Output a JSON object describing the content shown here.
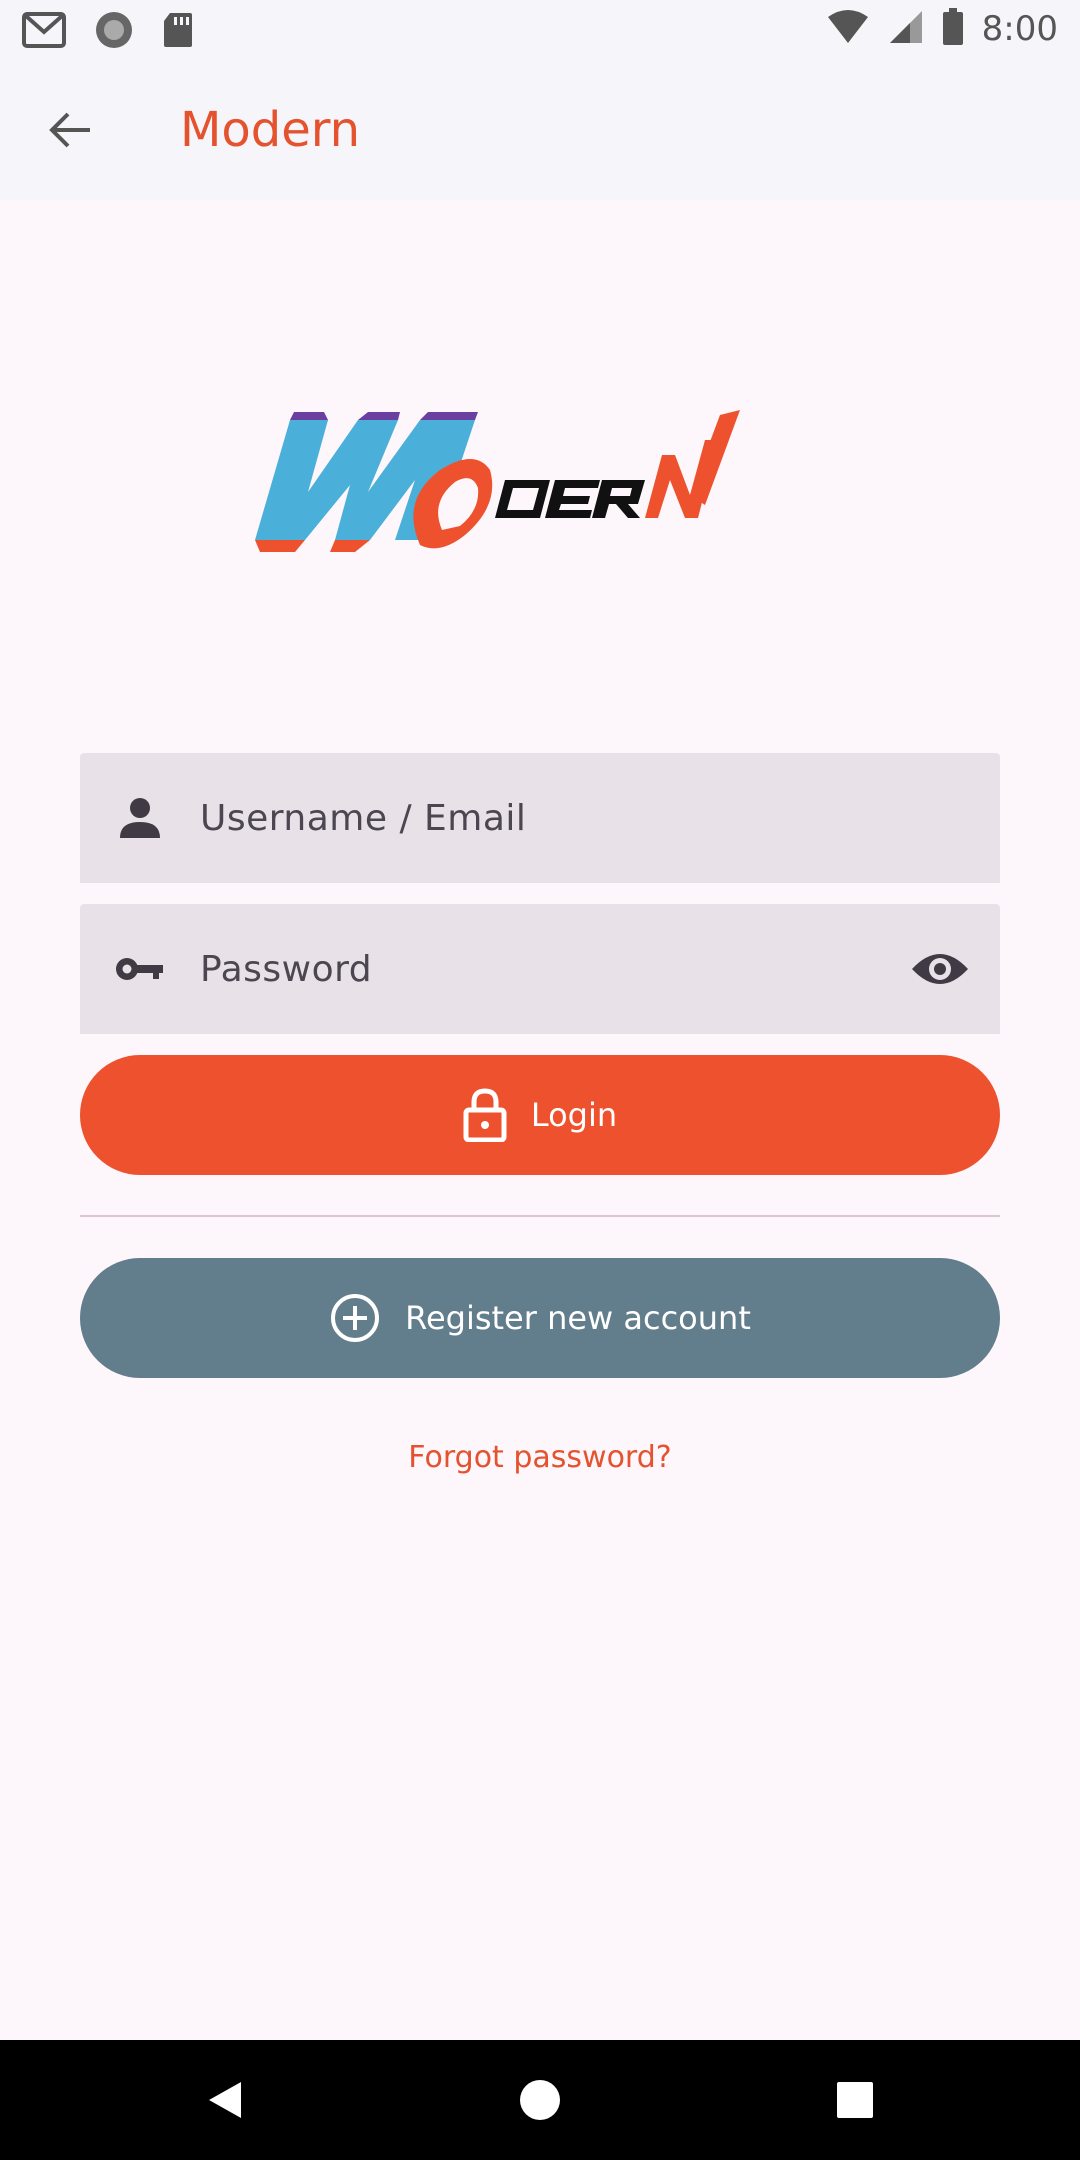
{
  "status_bar": {
    "time": "8:00",
    "left_icons": [
      "gmail-icon",
      "record-icon",
      "sd-card-icon"
    ],
    "right_icons": [
      "wifi-icon",
      "cell-signal-icon",
      "battery-icon"
    ]
  },
  "app_bar": {
    "title": "Modern",
    "back_icon": "arrow-back-icon"
  },
  "logo": {
    "text": "MODERN",
    "colors": {
      "blue": "#4ab0d9",
      "orange": "#ee512d",
      "purple": "#6b3fa0",
      "black": "#111111"
    }
  },
  "form": {
    "username": {
      "placeholder": "Username / Email",
      "value": "",
      "icon": "person-icon"
    },
    "password": {
      "placeholder": "Password",
      "value": "",
      "icon": "key-icon",
      "toggle_icon": "eye-icon"
    },
    "login_button": {
      "label": "Login",
      "icon": "lock-icon",
      "color": "#ee512d"
    },
    "register_button": {
      "label": "Register new account",
      "icon": "add-circle-icon",
      "color": "#627d8b"
    },
    "forgot_link": "Forgot password?"
  },
  "colors": {
    "accent": "#e4522e",
    "background": "#fdf6fb",
    "field_background": "#e8e1e8"
  }
}
